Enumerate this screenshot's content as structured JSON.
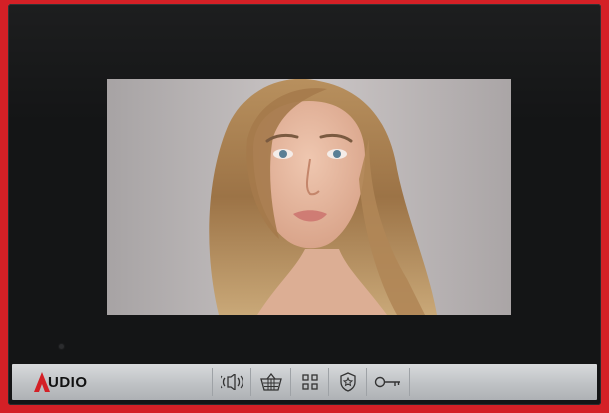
{
  "brand": {
    "name": "UDIO",
    "accent_color": "#d42026"
  },
  "screen": {
    "content": "portrait-camera-feed"
  },
  "buttons": [
    {
      "icon": "speaker-icon"
    },
    {
      "icon": "basket-icon"
    },
    {
      "icon": "grid-menu-icon"
    },
    {
      "icon": "shield-star-icon"
    },
    {
      "icon": "key-icon"
    }
  ],
  "colors": {
    "frame": "#d42026",
    "bezel": "#141516",
    "panel": "#c4c7ca"
  }
}
